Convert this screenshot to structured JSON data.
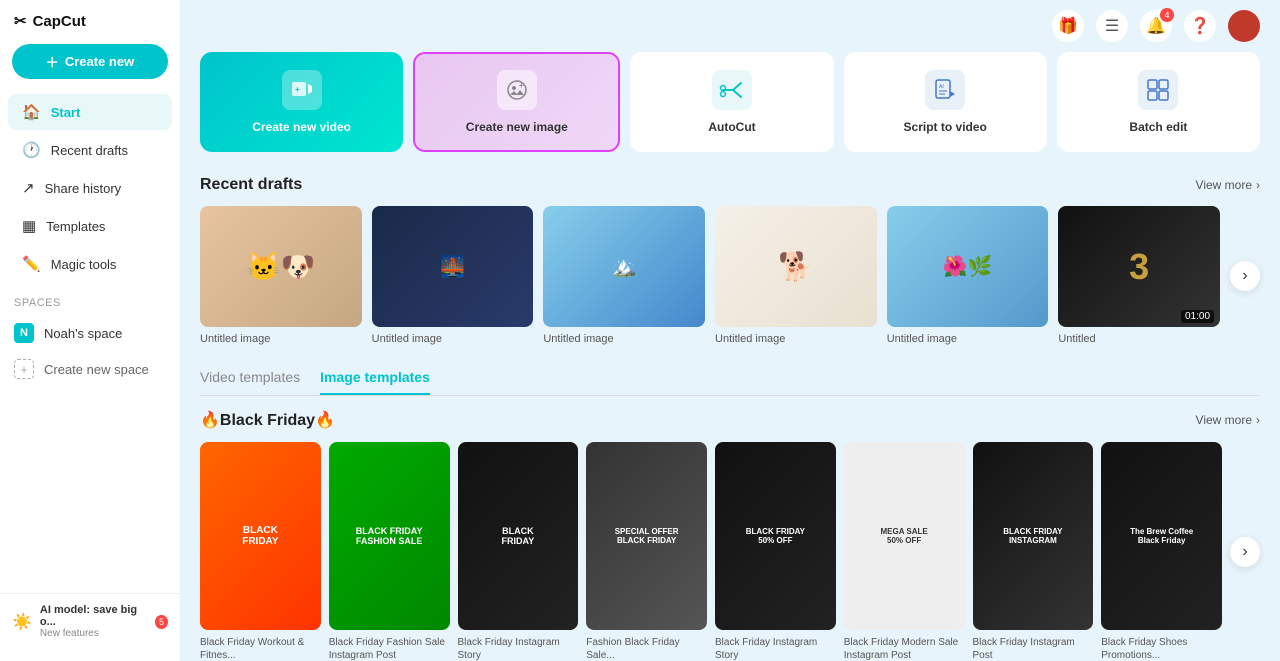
{
  "app": {
    "name": "CapCut"
  },
  "sidebar": {
    "create_btn": "Create new",
    "nav_items": [
      {
        "id": "start",
        "label": "Start",
        "icon": "🏠",
        "active": true
      },
      {
        "id": "recent-drafts",
        "label": "Recent drafts",
        "icon": "🕐",
        "active": false
      },
      {
        "id": "share-history",
        "label": "Share history",
        "icon": "↗️",
        "active": false
      },
      {
        "id": "templates",
        "label": "Templates",
        "icon": "▦",
        "active": false
      },
      {
        "id": "magic-tools",
        "label": "Magic tools",
        "icon": "✏️",
        "active": false
      }
    ],
    "spaces_label": "Spaces",
    "noah_space": "Noah's space",
    "create_space": "Create new space"
  },
  "topbar": {
    "gift_icon": "🎁",
    "menu_icon": "☰",
    "bell_icon": "🔔",
    "bell_badge": "4",
    "help_icon": "❓"
  },
  "quick_actions": [
    {
      "id": "create-video",
      "label": "Create new video",
      "icon": "🎬",
      "style": "video"
    },
    {
      "id": "create-image",
      "label": "Create new image",
      "icon": "🖼️",
      "style": "image"
    },
    {
      "id": "autocut",
      "label": "AutoCut",
      "icon": "✂️",
      "style": "autocut"
    },
    {
      "id": "script-to-video",
      "label": "Script to video",
      "icon": "📄",
      "style": "script"
    },
    {
      "id": "batch-edit",
      "label": "Batch edit",
      "icon": "⚙️",
      "style": "batch"
    }
  ],
  "recent_drafts": {
    "title": "Recent drafts",
    "view_more": "View more",
    "items": [
      {
        "label": "Untitled image",
        "thumb_class": "thumb-1",
        "emoji": "🐱🐶"
      },
      {
        "label": "Untitled image",
        "thumb_class": "thumb-2",
        "emoji": "🌉"
      },
      {
        "label": "Untitled image",
        "thumb_class": "thumb-3",
        "emoji": "🏔️"
      },
      {
        "label": "Untitled image",
        "thumb_class": "thumb-4",
        "emoji": "🐕"
      },
      {
        "label": "Untitled image",
        "thumb_class": "thumb-5",
        "emoji": "🌺"
      },
      {
        "label": "Untitled",
        "thumb_class": "thumb-6",
        "emoji": "3",
        "duration": "01:00"
      }
    ]
  },
  "templates": {
    "tabs": [
      {
        "id": "video-templates",
        "label": "Video templates",
        "active": false
      },
      {
        "id": "image-templates",
        "label": "Image templates",
        "active": true
      }
    ],
    "section_title": "🔥Black Friday🔥",
    "view_more": "View more",
    "items": [
      {
        "label": "Black Friday Workout & Fitnes...",
        "thumb_class": "tmpl-1"
      },
      {
        "label": "Black Friday Fashion Sale Instagram Post",
        "thumb_class": "tmpl-2"
      },
      {
        "label": "Black Friday Instagram Story",
        "thumb_class": "tmpl-3"
      },
      {
        "label": "Fashion Black Friday Sale...",
        "thumb_class": "tmpl-4"
      },
      {
        "label": "Black Friday Instagram Story",
        "thumb_class": "tmpl-5"
      },
      {
        "label": "Black Friday Modern Sale Instagram Post",
        "thumb_class": "tmpl-6"
      },
      {
        "label": "Black Friday Instagram Post",
        "thumb_class": "tmpl-7"
      },
      {
        "label": "Black Friday Shoes Promotions...",
        "thumb_class": "tmpl-8"
      }
    ]
  },
  "ai_banner": {
    "title": "AI model: save big o...",
    "subtitle": "New features",
    "badge": "5"
  }
}
